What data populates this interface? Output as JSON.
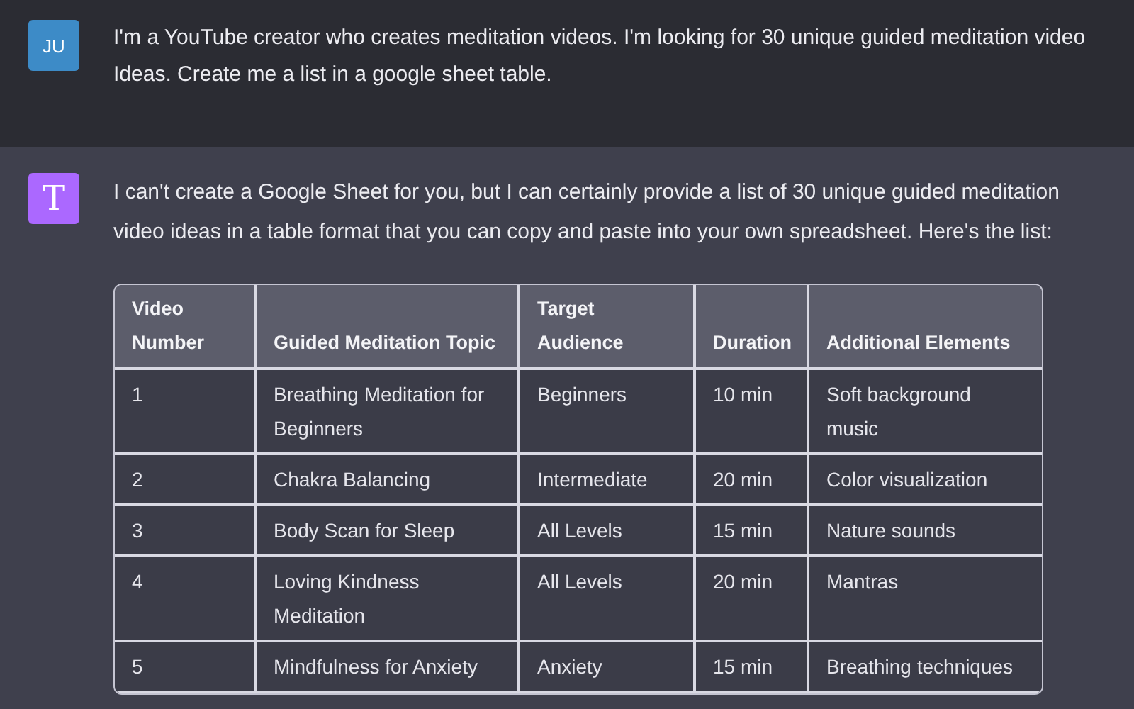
{
  "messages": [
    {
      "kind": "user",
      "avatar": "JU",
      "color": "#3d8bc7",
      "text": "I'm a YouTube creator who creates meditation videos. I'm looking for 30 unique guided meditation video Ideas. Create me a list in a google sheet table."
    },
    {
      "kind": "assistant",
      "avatar": "T",
      "color": "#ab68ff",
      "text": "I can't create a Google Sheet for you, but I can certainly provide a list of 30 unique guided meditation video ideas in a table format that you can copy and paste into your own spreadsheet. Here's the list:",
      "table": {
        "columns": [
          "Video Number",
          "Guided Meditation Topic",
          "Target Audience",
          "Duration",
          "Additional Elements"
        ],
        "rows": [
          [
            "1",
            "Breathing Meditation for Beginners",
            "Beginners",
            "10 min",
            "Soft background music"
          ],
          [
            "2",
            "Chakra Balancing",
            "Intermediate",
            "20 min",
            "Color visualization"
          ],
          [
            "3",
            "Body Scan for Sleep",
            "All Levels",
            "15 min",
            "Nature sounds"
          ],
          [
            "4",
            "Loving Kindness Meditation",
            "All Levels",
            "20 min",
            "Mantras"
          ],
          [
            "5",
            "Mindfulness for Anxiety",
            "Anxiety",
            "15 min",
            "Breathing techniques"
          ]
        ]
      }
    }
  ]
}
